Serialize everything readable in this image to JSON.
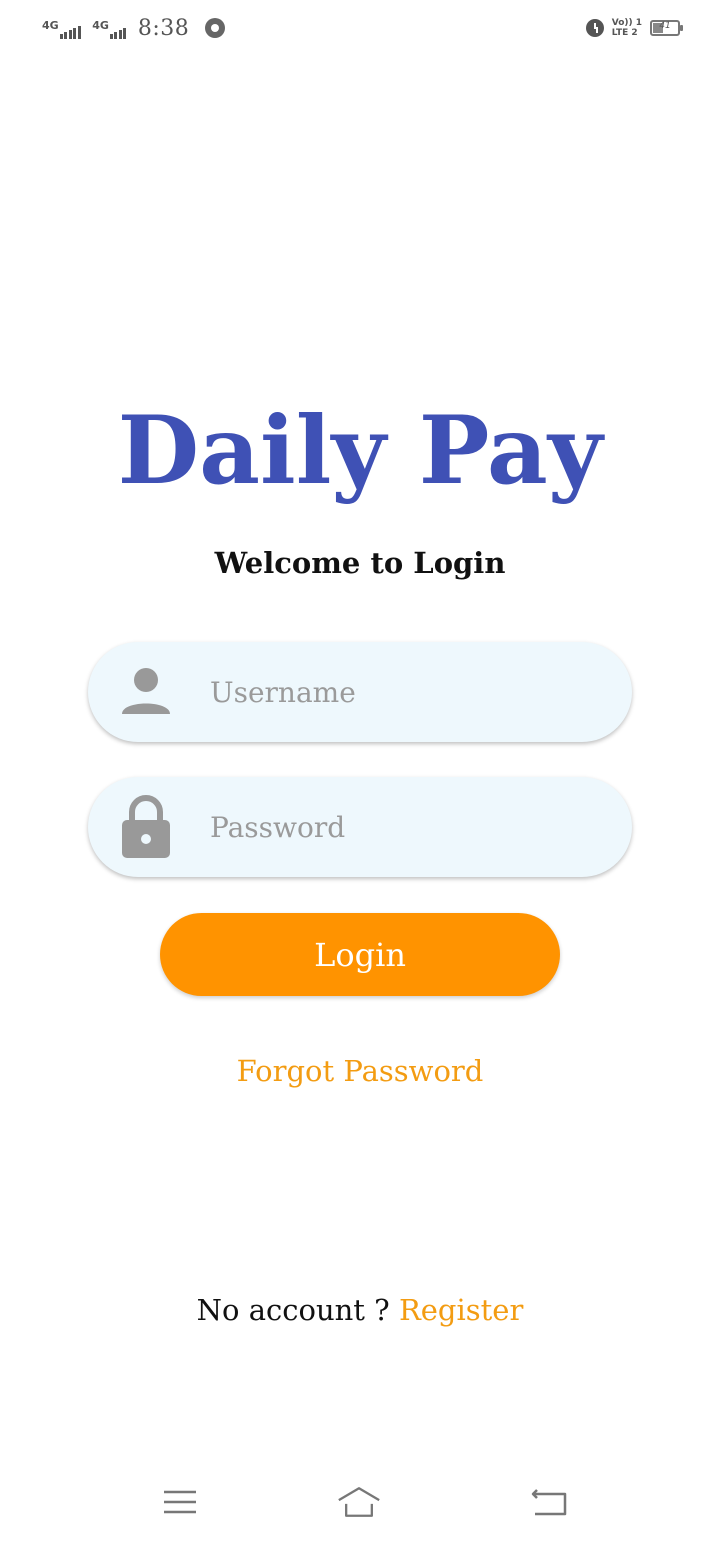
{
  "status_bar": {
    "network1": "4G",
    "network2": "4G",
    "time": "8:38",
    "volte_line1": "Vo)) 1",
    "volte_line2": "LTE 2",
    "battery": "41"
  },
  "app": {
    "title": "Daily Pay",
    "subtitle": "Welcome to Login"
  },
  "form": {
    "username_placeholder": "Username",
    "username_value": "",
    "password_placeholder": "Password",
    "password_value": "",
    "login_label": "Login",
    "forgot_label": "Forgot Password",
    "no_account_text": "No account ? ",
    "register_label": "Register"
  },
  "colors": {
    "title": "#3f51b5",
    "accent": "#ff9300",
    "link": "#f39c12",
    "field_bg": "#eef8fd",
    "icon": "#999999"
  },
  "icons": {
    "username": "person-icon",
    "password": "lock-icon",
    "nav_menu": "menu-icon",
    "nav_home": "home-icon",
    "nav_back": "back-icon"
  }
}
